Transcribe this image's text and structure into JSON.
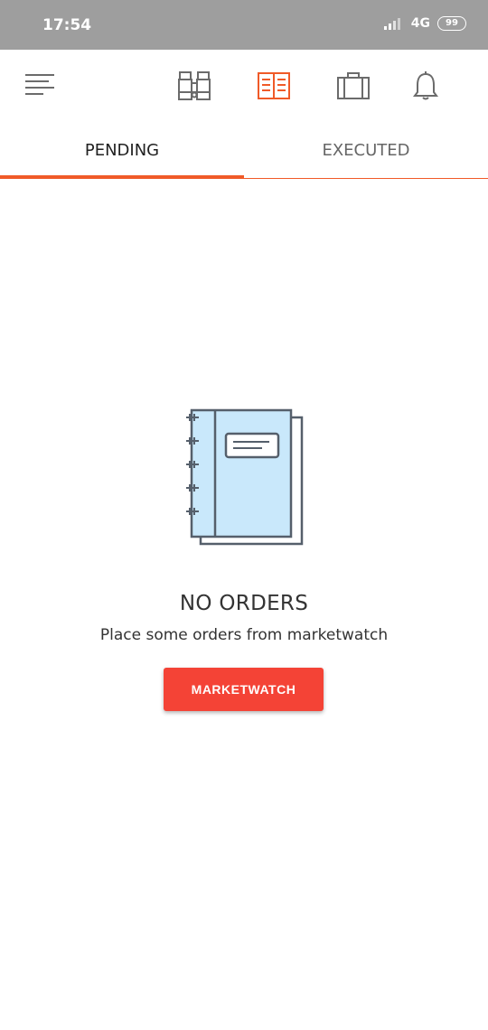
{
  "status_bar": {
    "time": "17:54",
    "network": "4G",
    "battery": "99"
  },
  "toolbar": {
    "icons": [
      "menu-icon",
      "binoculars-icon",
      "orderbook-icon",
      "briefcase-icon",
      "bell-icon"
    ],
    "active_color": "#f05a28",
    "inactive_color": "#6b6b6b"
  },
  "tabs": [
    {
      "label": "PENDING",
      "active": true
    },
    {
      "label": "EXECUTED",
      "active": false
    }
  ],
  "empty_state": {
    "title": "NO ORDERS",
    "subtitle": "Place some orders from marketwatch",
    "button_label": "MARKETWATCH"
  },
  "colors": {
    "accent": "#f05a28",
    "button": "#f44336",
    "status_bar": "#9e9e9e",
    "illustration_fill": "#c9e8fb"
  }
}
